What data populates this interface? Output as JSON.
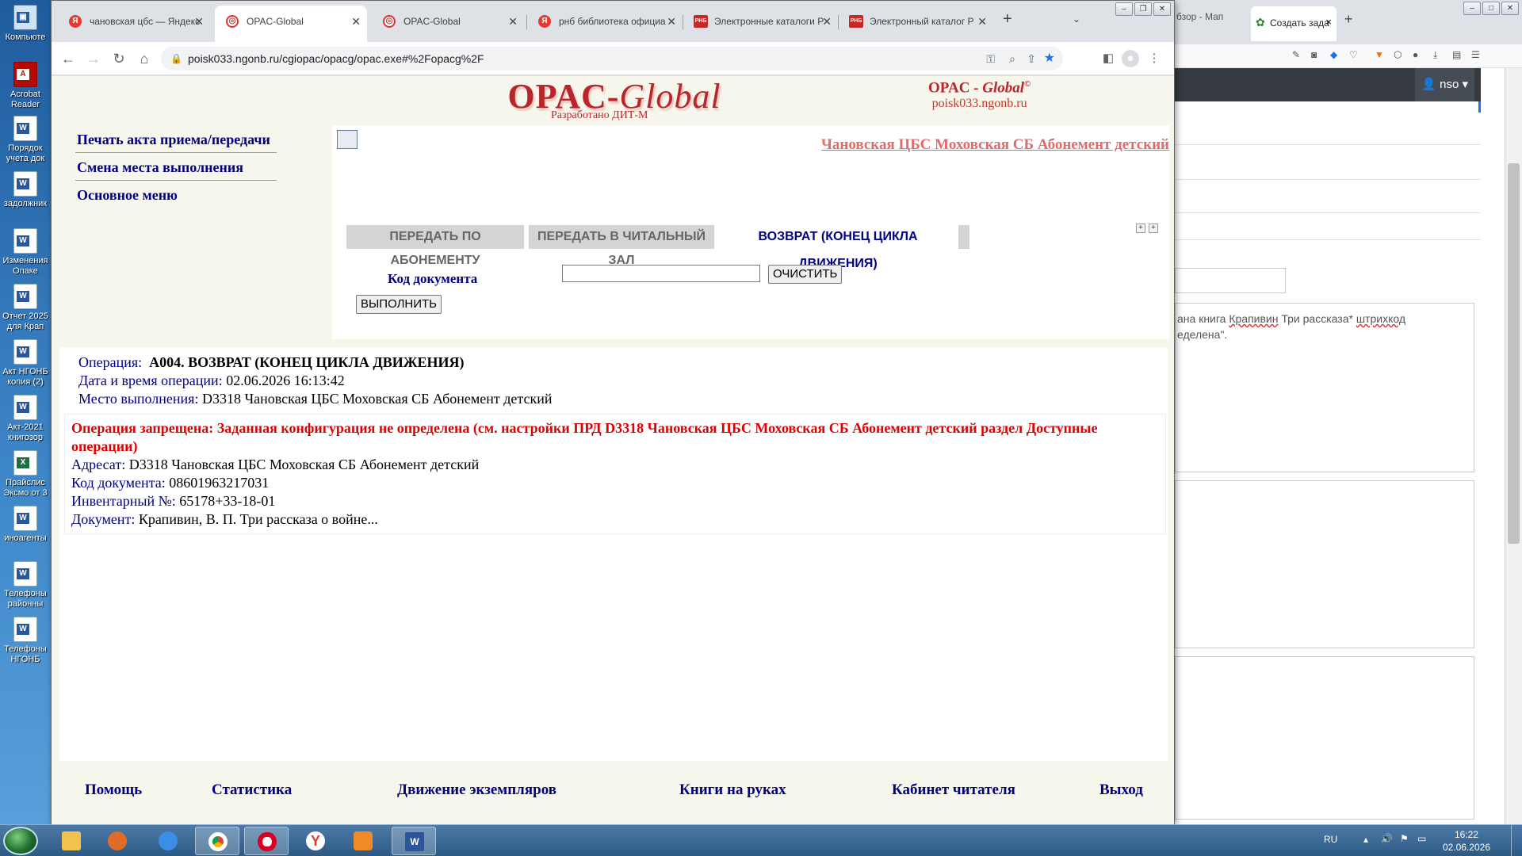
{
  "desktop_icons": [
    "Компьюте",
    "Acrobat Reader",
    "Порядок учета док",
    "задолжник",
    "Изменения Опаке",
    "Отчет 2025 для Крап",
    "Акт НГОНБ копия (2)",
    "Акт-2021 книгозор",
    "Прайслис Эксмо от 3",
    "иноагенты",
    "Телефоны районны",
    "Телефоны НГОНБ"
  ],
  "browser": {
    "tabs": [
      {
        "label": "чановская цбс — Яндекс",
        "favicon": "Я",
        "color": "#e53935"
      },
      {
        "label": "OPAC-Global",
        "favicon": "◎",
        "color": "#d33"
      },
      {
        "label": "OPAC-Global",
        "favicon": "◎",
        "color": "#d33"
      },
      {
        "label": "рнб библиотека официа",
        "favicon": "Я",
        "color": "#e53935"
      },
      {
        "label": "Электронные каталоги Р",
        "favicon": "РНБ",
        "color": "#c62828"
      },
      {
        "label": "Электронный каталог Р",
        "favicon": "РНБ",
        "color": "#c62828"
      }
    ],
    "new_tab_glyph": "+",
    "url": "poisk033.ngonb.ru/cgiopac/opacg/opac.exe#%2Fopacg%2F"
  },
  "page": {
    "logo_main": "OPAC-",
    "logo_italic": "Global",
    "developer": "Разработано ДИТ-М",
    "right_title": "OPAC - ",
    "right_title_italic": "Global",
    "right_copy": "©",
    "right_host": "poisk033.ngonb.ru",
    "left_nav": [
      "Печать акта приема/передачи",
      "Смена места выполнения",
      "Основное меню"
    ],
    "location_link": "Чановская ЦБС Моховская СБ Абонемент детский",
    "tabs": [
      "ПЕРЕДАТЬ ПО АБОНЕМЕНТУ",
      "ПЕРЕДАТЬ В ЧИТАЛЬНЫЙ ЗАЛ",
      "ВОЗВРАТ (КОНЕЦ ЦИКЛА ДВИЖЕНИЯ)"
    ],
    "doc_code_label": "Код документа",
    "doc_code_value": "",
    "clear_button": "ОЧИСТИТЬ",
    "execute_button": "ВЫПОЛНИТЬ",
    "operation_label": "Операция:",
    "operation_value": "A004. ВОЗВРАТ (КОНЕЦ ЦИКЛА ДВИЖЕНИЯ)",
    "datetime_label": "Дата и время операции:",
    "datetime_value": "02.06.2026 16:13:42",
    "place_label": "Место выполнения:",
    "place_value": "D3318 Чановская ЦБС Моховская СБ Абонемент детский",
    "error_text": "Операция запрещена: Заданная конфигурация не определена (см. настройки ПРД D3318 Чановская ЦБС Моховская СБ Абонемент детский раздел Доступные операции)",
    "addressee_label": "Адресат:",
    "addressee_value": "D3318 Чановская ЦБС Моховская СБ Абонемент детский",
    "code_label": "Код документа:",
    "code_value": "08601963217031",
    "inv_label": "Инвентарный №:",
    "inv_value": "65178+33-18-01",
    "doc_label": "Документ:",
    "doc_value": "Крапивин, В. П. Три рассказа о войне...",
    "bottom_nav": [
      "Помощь",
      "Статистика",
      "Движение экземпляров",
      "Книги на руках",
      "Кабинет читателя",
      "Выход"
    ]
  },
  "right_window": {
    "tab1": "бзор - Мап",
    "tab2": "Создать зада",
    "user": "nso",
    "text_line1_a": "ана книга ",
    "text_line1_b": "Крапивин",
    "text_line1_c": " Три рассказа* ",
    "text_line1_d": "штрихкод",
    "text_line2": "еделена\"."
  },
  "taskbar": {
    "lang": "RU",
    "time": "16:22",
    "date": "02.06.2026"
  }
}
